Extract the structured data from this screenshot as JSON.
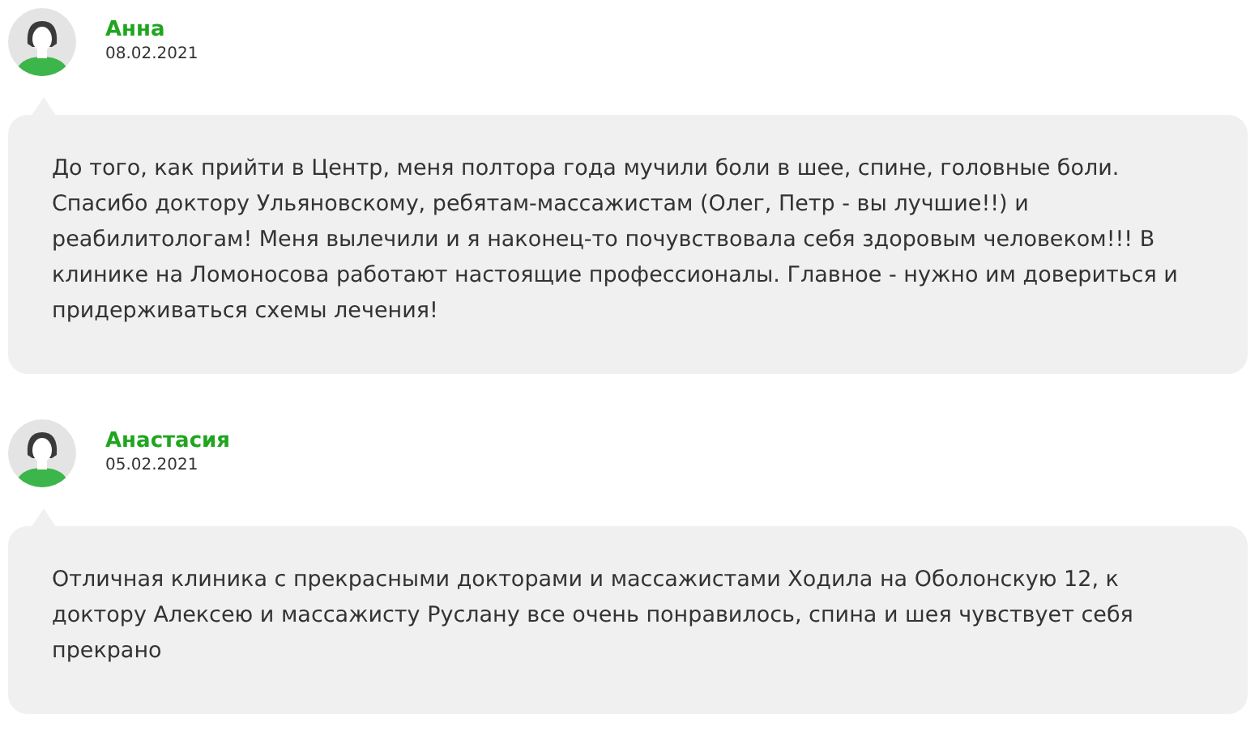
{
  "reviews": [
    {
      "author": "Анна",
      "date": "08.02.2021",
      "text": "До того, как прийти в Центр, меня полтора года мучили боли в шее, спине, головные боли. Спасибо доктору Ульяновскому, ребятам-массажистам (Олег, Петр - вы лучшие!!) и реабилитологам! Меня вылечили и я наконец-то почувствовала себя здоровым человеком!!! В клинике на Ломоносова работают настоящие профессионалы. Главное - нужно им довериться и придерживаться схемы лечения!"
    },
    {
      "author": "Анастасия",
      "date": "05.02.2021",
      "text": "Отличная клиника с прекрасными докторами и массажистами Ходила на Оболонскую 12, к доктору Алексею и массажисту Руслану все очень понравилось, спина и шея чувствует себя прекрано"
    }
  ]
}
